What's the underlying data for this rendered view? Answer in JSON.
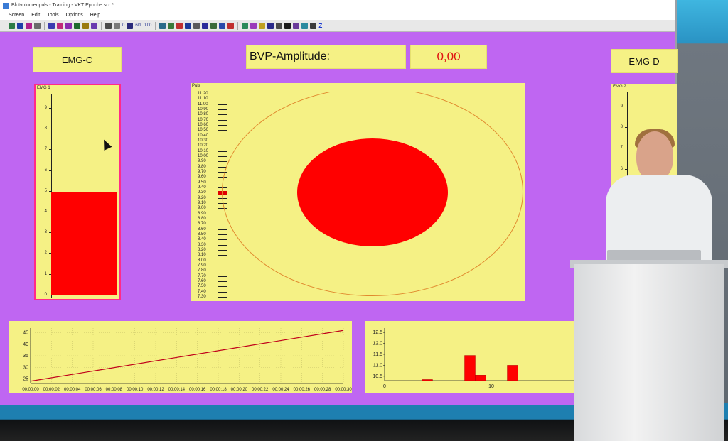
{
  "window": {
    "title": "Blutvolumenpuls - Training - VKT Epoche.scr *",
    "menu": [
      "Screen",
      "Edit",
      "Tools",
      "Options",
      "Help"
    ],
    "toolbar_readouts": [
      "0",
      "6/1",
      "0.00"
    ]
  },
  "labels": {
    "emg_c": "EMG-C",
    "emg_d": "EMG-D",
    "bvp_title": "BVP-Amplitude:",
    "bvp_value": "0,00"
  },
  "emg1": {
    "title": "EMG 1",
    "ticks": [
      "9",
      "8",
      "7",
      "6",
      "5",
      "4",
      "3",
      "2",
      "1",
      "0"
    ],
    "value": 5.0,
    "ylim": [
      0,
      10
    ]
  },
  "emg2": {
    "title": "EMG 2",
    "ticks": [
      "9",
      "8",
      "7",
      "6",
      "5",
      "4"
    ]
  },
  "pulse": {
    "title": "Puls",
    "ticks": [
      "11.20",
      "11.10",
      "11.00",
      "10.90",
      "10.80",
      "10.70",
      "10.60",
      "10.50",
      "10.40",
      "10.30",
      "10.20",
      "10.10",
      "10.00",
      "9.90",
      "9.80",
      "9.70",
      "9.60",
      "9.50",
      "9.40",
      "9.30",
      "9.20",
      "9.10",
      "9.00",
      "8.90",
      "8.80",
      "8.70",
      "8.60",
      "8.50",
      "8.40",
      "8.30",
      "8.20",
      "8.10",
      "8.00",
      "7.90",
      "7.80",
      "7.70",
      "7.60",
      "7.50",
      "7.40",
      "7.30"
    ],
    "marker_value": 9.3
  },
  "chart_data": [
    {
      "type": "line",
      "x": [
        "00:00:00",
        "00:00:30"
      ],
      "y": [
        24,
        46
      ],
      "xticks": [
        "00:00:00",
        "00:00:02",
        "00:00:04",
        "00:00:06",
        "00:00:08",
        "00:00:10",
        "00:00:12",
        "00:00:14",
        "00:00:16",
        "00:00:18",
        "00:00:20",
        "00:00:22",
        "00:00:24",
        "00:00:26",
        "00:00:28",
        "00:00:30"
      ],
      "yticks": [
        "45",
        "40",
        "35",
        "30",
        "25"
      ],
      "ylim": [
        23,
        47
      ],
      "grid": true,
      "color": "#c0001a"
    },
    {
      "type": "bar",
      "bars": [
        {
          "x0": 3.5,
          "x1": 4.5,
          "y": 10.35
        },
        {
          "x0": 7.5,
          "x1": 8.5,
          "y": 11.45
        },
        {
          "x0": 8.5,
          "x1": 9.5,
          "y": 10.55
        },
        {
          "x0": 11.5,
          "x1": 12.5,
          "y": 11.0
        }
      ],
      "xticks": [
        "0",
        "10"
      ],
      "xlim": [
        0,
        18
      ],
      "yticks": [
        "12.5",
        "12.0",
        "11.5",
        "11.0",
        "10.5"
      ],
      "ylim": [
        10.3,
        12.7
      ],
      "color": "#ff0000"
    }
  ]
}
